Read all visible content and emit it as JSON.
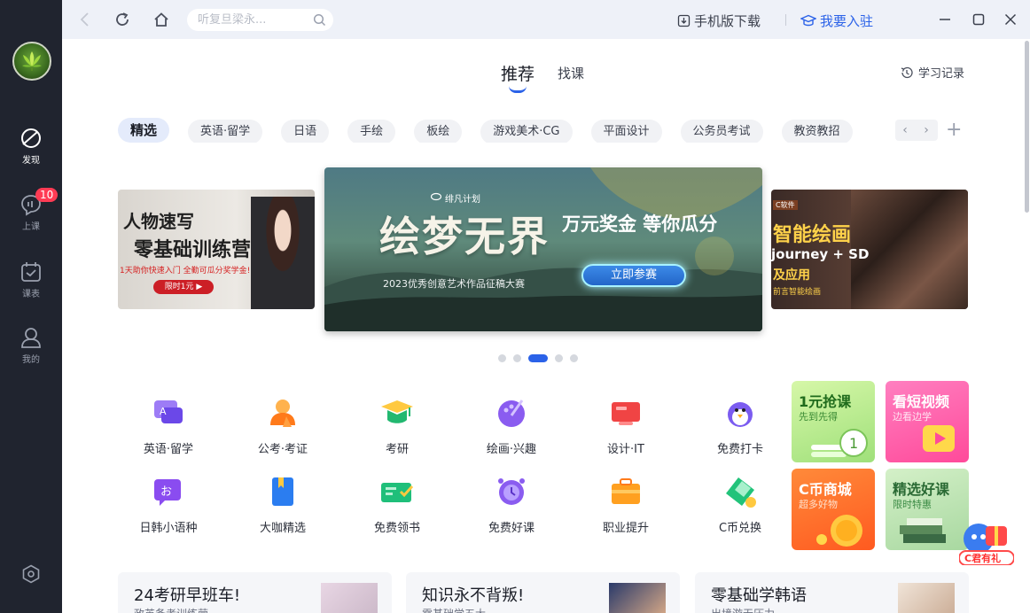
{
  "sidebar": {
    "items": [
      {
        "label": "发现",
        "icon": "compass-icon",
        "active": true
      },
      {
        "label": "上课",
        "icon": "chat-bubble-icon",
        "badge": "10"
      },
      {
        "label": "课表",
        "icon": "calendar-icon"
      },
      {
        "label": "我的",
        "icon": "user-icon"
      }
    ],
    "settings_icon": "settings-hexagon-icon"
  },
  "titlebar": {
    "search_placeholder": "听复旦梁永...",
    "mobile_download": "手机版下载",
    "join": "我要入驻"
  },
  "tabs": {
    "recommend": "推荐",
    "find_course": "找课",
    "history": "学习记录"
  },
  "categories": [
    "精选",
    "英语·留学",
    "日语",
    "手绘",
    "板绘",
    "游戏美术·CG",
    "平面设计",
    "公务员考试",
    "教资教招"
  ],
  "banners": {
    "left": {
      "title1": "人物速写",
      "title2": "零基础训练营",
      "sub": "1天助你快速入门  全勤可瓜分奖学金!",
      "button": "限时1元 ▶"
    },
    "main": {
      "tag": "绯凡计划",
      "title": "绘梦无界",
      "slogan": "万元奖金 等你瓜分",
      "button": "立即参赛",
      "subtitle": "2023优秀创意艺术作品征稿大赛"
    },
    "right": {
      "tag": "C软件",
      "title": "智能绘画",
      "line2": "journey + SD",
      "line3": "及应用",
      "sub": "前言智能绘画"
    },
    "dots_count": 5,
    "active_dot": 2
  },
  "icon_grid": [
    {
      "label": "英语·留学",
      "icon": "language-chat-icon",
      "color": "#7b5cf0"
    },
    {
      "label": "公考·考证",
      "icon": "officer-icon",
      "color": "#ff8a2b"
    },
    {
      "label": "考研",
      "icon": "graduation-cap-icon",
      "color": "#22c37a"
    },
    {
      "label": "绘画·兴趣",
      "icon": "palette-icon",
      "color": "#8a5cf0"
    },
    {
      "label": "设计·IT",
      "icon": "monitor-icon",
      "color": "#f04444"
    },
    {
      "label": "免费打卡",
      "icon": "penguin-icon",
      "color": "#ffb020"
    },
    {
      "label": "日韩小语种",
      "icon": "japanese-chat-icon",
      "color": "#8a4cf0"
    },
    {
      "label": "大咖精选",
      "icon": "bookmark-book-icon",
      "color": "#2b7df0"
    },
    {
      "label": "免费领书",
      "icon": "ticket-check-icon",
      "color": "#1fbf7a"
    },
    {
      "label": "免费好课",
      "icon": "alarm-clock-icon",
      "color": "#8a5cf0"
    },
    {
      "label": "职业提升",
      "icon": "briefcase-icon",
      "color": "#ffa020"
    },
    {
      "label": "C币兑换",
      "icon": "coin-ticket-icon",
      "color": "#22c37a"
    }
  ],
  "promos": [
    {
      "title": "1元抢课",
      "sub": "先到先得",
      "bg": "#b9ec8c",
      "fg": "#1f6b1c"
    },
    {
      "title": "看短视频",
      "sub": "边看边学",
      "bg": "#ff5fa8",
      "fg": "#ffffff"
    },
    {
      "title": "C币商城",
      "sub": "超多好物",
      "bg": "#ff7a2e",
      "fg": "#ffffff"
    },
    {
      "title": "精选好课",
      "sub": "限时特惠",
      "bg": "#bfe3bd",
      "fg": "#2a6a34"
    }
  ],
  "floater_label": "C君有礼",
  "cards": [
    {
      "title": "24考研早班车!",
      "sub": "政英备考训练营"
    },
    {
      "title": "知识永不背叛!",
      "sub": "零基础学五大..."
    },
    {
      "title": "零基础学韩语",
      "sub": "出境游无压力"
    }
  ]
}
